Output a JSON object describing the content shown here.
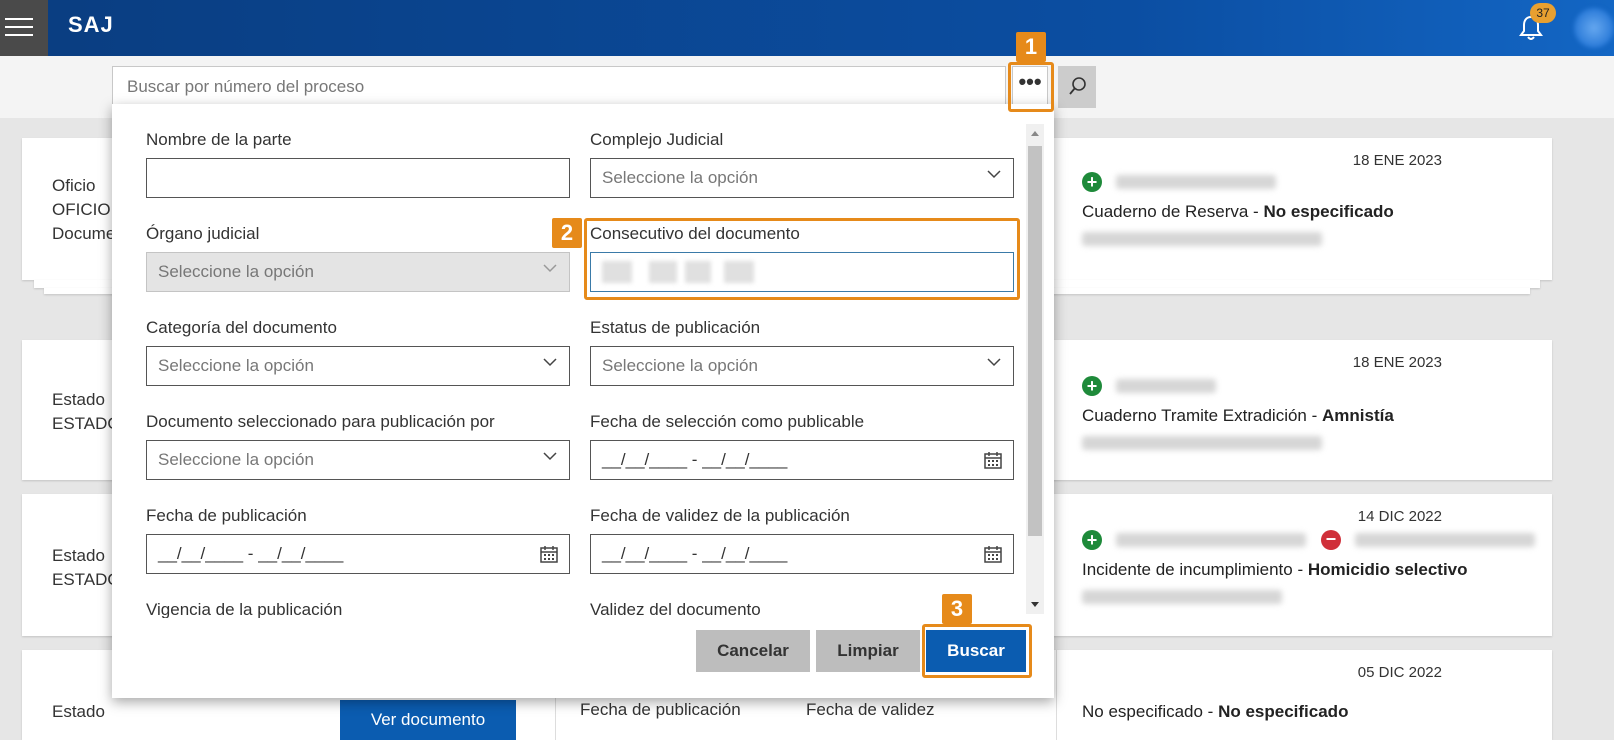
{
  "header": {
    "brand": "SAJ",
    "notifications_count": "37"
  },
  "search": {
    "placeholder": "Buscar por número del proceso"
  },
  "filters": {
    "nombre_parte_label": "Nombre de la parte",
    "complejo_label": "Complejo Judicial",
    "complejo_value": "Seleccione la opción",
    "organo_label": "Órgano judicial",
    "organo_value": "Seleccione la opción",
    "consecutivo_label": "Consecutivo del documento",
    "categoria_label": "Categoría del documento",
    "categoria_value": "Seleccione la opción",
    "estatus_label": "Estatus de publicación",
    "estatus_value": "Seleccione la opción",
    "doc_seleccionado_label": "Documento seleccionado para publicación por",
    "doc_seleccionado_value": "Seleccione la opción",
    "fecha_seleccion_label": "Fecha de selección como publicable",
    "fecha_seleccion_value": "__/__/____ - __/__/____",
    "fecha_publicacion_label": "Fecha de publicación",
    "fecha_publicacion_value": "__/__/____ - __/__/____",
    "fecha_validez_label": "Fecha de validez de la publicación",
    "fecha_validez_value": "__/__/____ - __/__/____",
    "vigencia_label": "Vigencia de la publicación",
    "validez_doc_label": "Validez del documento"
  },
  "buttons": {
    "cancelar": "Cancelar",
    "limpiar": "Limpiar",
    "buscar": "Buscar"
  },
  "annotations": {
    "step1": "1",
    "step2": "2",
    "step3": "3"
  },
  "cards": [
    {
      "left_lines": [
        "Oficio",
        "OFICIO.",
        "Docume"
      ],
      "date": "18 ENE 2023",
      "cuaderno": "Cuaderno de Reserva - ",
      "cuaderno_bold": "No especificado"
    },
    {
      "left_lines": [
        "Estado",
        "ESTADO"
      ],
      "date": "18 ENE 2023",
      "cuaderno": "Cuaderno Tramite Extradición - ",
      "cuaderno_bold": "Amnistía"
    },
    {
      "left_lines": [
        "Estado",
        "ESTADO"
      ],
      "date": "14 DIC 2022",
      "cuaderno": "Incidente de incumplimiento - ",
      "cuaderno_bold": "Homicidio selectivo"
    },
    {
      "left_lines": [
        "Estado"
      ],
      "date": "05 DIC 2022",
      "cuaderno": "No especificado - ",
      "cuaderno_bold": "No especificado"
    }
  ],
  "bottom_row": {
    "ver_documento": "Ver documento",
    "fecha_publicacion": "Fecha de publicación",
    "fecha_validez": "Fecha de validez"
  },
  "colors": {
    "brand_blue": "#0b4ea2",
    "accent_orange": "#e68a1a",
    "button_blue": "#0b5cb0"
  }
}
